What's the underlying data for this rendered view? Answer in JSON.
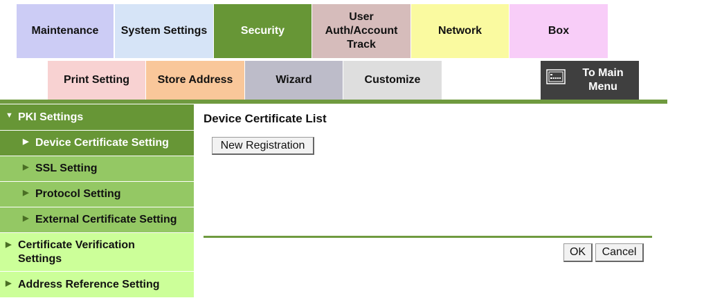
{
  "top_tabs": [
    {
      "label": "Maintenance",
      "color": "#ccccf5"
    },
    {
      "label": "System Settings",
      "color": "#d6e4f7"
    },
    {
      "label": "Security",
      "color": "#679636",
      "active": true
    },
    {
      "label": "User\nAuth/Account\nTrack",
      "color": "#d6bcbb"
    },
    {
      "label": "Network",
      "color": "#fafaa0"
    },
    {
      "label": "Box",
      "color": "#f8cdf8"
    }
  ],
  "second_tabs": [
    {
      "label": "Print Setting",
      "color": "#f8d2d2"
    },
    {
      "label": "Store Address",
      "color": "#f9c79a"
    },
    {
      "label": "Wizard",
      "color": "#bdbcc9"
    },
    {
      "label": "Customize",
      "color": "#dedede"
    }
  ],
  "to_main_menu": {
    "label": "To Main Menu",
    "icon": "main-menu-icon"
  },
  "sidebar": {
    "pki_settings": "PKI Settings",
    "items": [
      {
        "label": "Device Certificate Setting"
      },
      {
        "label": "SSL Setting"
      },
      {
        "label": "Protocol Setting"
      },
      {
        "label": "External Certificate Setting"
      }
    ],
    "certificate_verification": "Certificate Verification Settings",
    "address_reference": "Address Reference Setting"
  },
  "main": {
    "title": "Device Certificate List",
    "new_registration_label": "New Registration",
    "ok_label": "OK",
    "cancel_label": "Cancel"
  },
  "colors": {
    "accent_green": "#6f9a3f",
    "sidebar_dark": "#679636",
    "sidebar_medium": "#94c864",
    "sidebar_light": "#ccff99"
  }
}
